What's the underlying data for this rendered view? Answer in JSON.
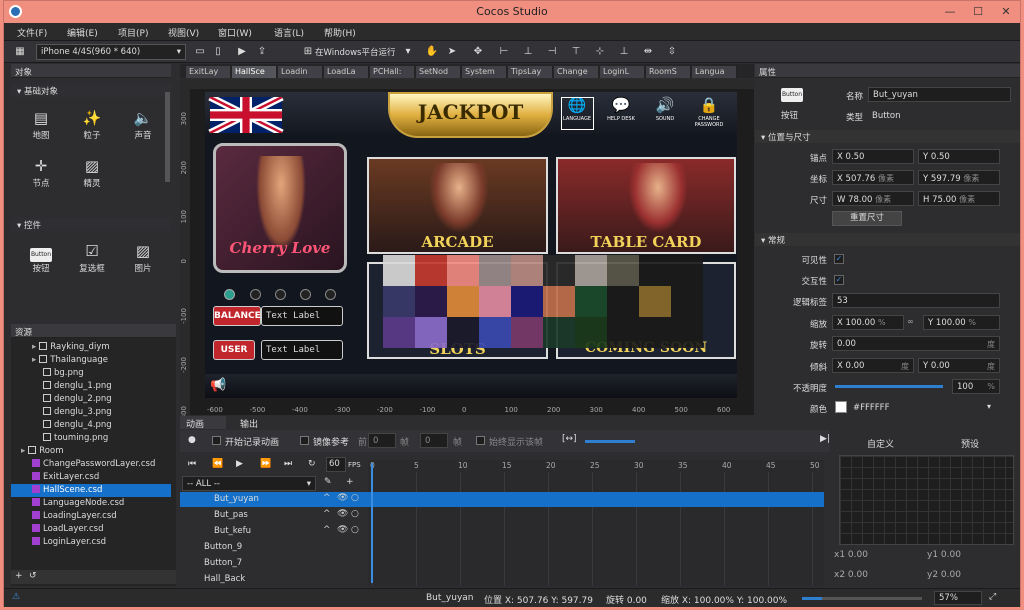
{
  "window": {
    "title": "Cocos Studio"
  },
  "menu": [
    "文件(F)",
    "编辑(E)",
    "项目(P)",
    "视图(V)",
    "窗口(W)",
    "语言(L)",
    "帮助(H)"
  ],
  "toolbar": {
    "device": "iPhone 4/4S(960 * 640)",
    "run": "在Windows平台运行"
  },
  "objects_panel": {
    "title": "对象",
    "basic_header": "基础对象",
    "basic": [
      {
        "label": "地图",
        "icon": "map-icon"
      },
      {
        "label": "粒子",
        "icon": "particle-icon"
      },
      {
        "label": "声音",
        "icon": "sound-icon"
      },
      {
        "label": "节点",
        "icon": "node-icon"
      },
      {
        "label": "精灵",
        "icon": "sprite-icon"
      }
    ],
    "controls_header": "控件",
    "controls": [
      {
        "label": "按钮",
        "icon": "button-icon"
      },
      {
        "label": "复选框",
        "icon": "checkbox-icon"
      },
      {
        "label": "图片",
        "icon": "image-icon"
      }
    ],
    "button_icon_text": "Button"
  },
  "resources_panel": {
    "title": "资源",
    "items": [
      {
        "label": "Rayking_diym",
        "type": "folder",
        "indent": 1
      },
      {
        "label": "Thailanguage",
        "type": "folder",
        "indent": 1
      },
      {
        "label": "bg.png",
        "type": "png",
        "indent": 2
      },
      {
        "label": "denglu_1.png",
        "type": "png",
        "indent": 2
      },
      {
        "label": "denglu_2.png",
        "type": "png",
        "indent": 2
      },
      {
        "label": "denglu_3.png",
        "type": "png",
        "indent": 2
      },
      {
        "label": "denglu_4.png",
        "type": "png",
        "indent": 2
      },
      {
        "label": "touming.png",
        "type": "png",
        "indent": 2
      },
      {
        "label": "Room",
        "type": "folder",
        "indent": 0
      },
      {
        "label": "ChangePasswordLayer.csd",
        "type": "csd",
        "indent": 1
      },
      {
        "label": "ExitLayer.csd",
        "type": "csd",
        "indent": 1
      },
      {
        "label": "HallScene.csd",
        "type": "csd",
        "indent": 1,
        "selected": true
      },
      {
        "label": "LanguageNode.csd",
        "type": "csd",
        "indent": 1
      },
      {
        "label": "LoadingLayer.csd",
        "type": "csd",
        "indent": 1
      },
      {
        "label": "LoadLayer.csd",
        "type": "csd",
        "indent": 1
      },
      {
        "label": "LoginLayer.csd",
        "type": "csd",
        "indent": 1
      }
    ]
  },
  "doc_tabs": [
    "ExitLay",
    "HallSce",
    "Loadin",
    "LoadLa",
    "PCHall:",
    "SetNod",
    "System",
    "TipsLay",
    "Change",
    "LoginL",
    "RoomS",
    "Langua"
  ],
  "active_tab": 1,
  "canvas": {
    "jackpot": "JACKPOT",
    "icons": [
      {
        "label": "LANGUAGE",
        "icon": "globe-icon"
      },
      {
        "label": "HELP DESK",
        "icon": "chat-icon"
      },
      {
        "label": "SOUND",
        "icon": "speaker-icon"
      },
      {
        "label": "CHANGE PASSWORD",
        "icon": "lock-icon"
      }
    ],
    "games": [
      "ARCADE",
      "TABLE CARD",
      "SLOTS",
      "COMING SOON"
    ],
    "avatar_caption": "Cherry Love",
    "balance_label": "BALANCE",
    "user_label": "USER",
    "text_label": "Text Label",
    "ruler_x": [
      "-600",
      "-500",
      "-400",
      "-300",
      "-200",
      "-100",
      "0",
      "100",
      "200",
      "300",
      "400",
      "500",
      "600"
    ],
    "ruler_y": [
      "300",
      "200",
      "100",
      "0",
      "-100",
      "-200",
      "-300"
    ]
  },
  "properties": {
    "title": "属性",
    "widget_label": "按钮",
    "widget_icon_text": "Button",
    "name_label": "名称",
    "name_value": "But_yuyan",
    "type_label": "类型",
    "type_value": "Button",
    "pos_section": "位置与尺寸",
    "anchor_label": "锚点",
    "anchor_x": "0.50",
    "anchor_y": "0.50",
    "pos_label": "坐标",
    "pos_x": "507.76",
    "pos_y": "597.79",
    "pos_unit": "像素",
    "size_label": "尺寸",
    "size_w": "78.00",
    "size_h": "75.00",
    "size_unit": "像素",
    "reset_size": "重置尺寸",
    "general_section": "常规",
    "visible_label": "可见性",
    "interactive_label": "交互性",
    "tag_label": "逻辑标签",
    "tag_value": "53",
    "scale_label": "缩放",
    "scale_x": "100.00",
    "scale_y": "100.00",
    "percent": "%",
    "rotate_label": "旋转",
    "rotate_value": "0.00",
    "rotate_unit": "度",
    "skew_label": "倾斜",
    "skew_x": "0.00",
    "skew_y": "0.00",
    "opacity_label": "不透明度",
    "opacity_value": "100",
    "opacity_fraction": 1.0,
    "color_label": "颜色",
    "color_value": "#FFFFFF"
  },
  "animation": {
    "tab_anim": "动画",
    "tab_output": "输出",
    "record": "开始记录动画",
    "onion": "镜像参考",
    "prev_label": "前",
    "prev_value": "0",
    "frame_unit": "帧",
    "next_value": "0",
    "always_show": "始终显示该帧",
    "fps": "60",
    "fps_label": "FPS",
    "filter": "-- ALL --",
    "timeline_ticks": [
      "0",
      "5",
      "10",
      "15",
      "20",
      "25",
      "30",
      "35",
      "40",
      "45",
      "50"
    ],
    "tracks": [
      {
        "label": "But_yuyan",
        "selected": true
      },
      {
        "label": "But_pas"
      },
      {
        "label": "But_kefu"
      },
      {
        "label": "Button_9"
      },
      {
        "label": "Button_7"
      },
      {
        "label": "Hall_Back"
      }
    ]
  },
  "curve": {
    "tab_custom": "自定义",
    "tab_preset": "预设",
    "x1": "0.00",
    "y1": "0.00",
    "x2": "0.00",
    "y2": "0.00"
  },
  "status": {
    "name": "But_yuyan",
    "pos": "位置 X: 507.76  Y: 597.79",
    "rotate": "旋转 0.00",
    "scale": "缩放 X: 100.00%  Y: 100.00%",
    "zoom": "57%"
  }
}
